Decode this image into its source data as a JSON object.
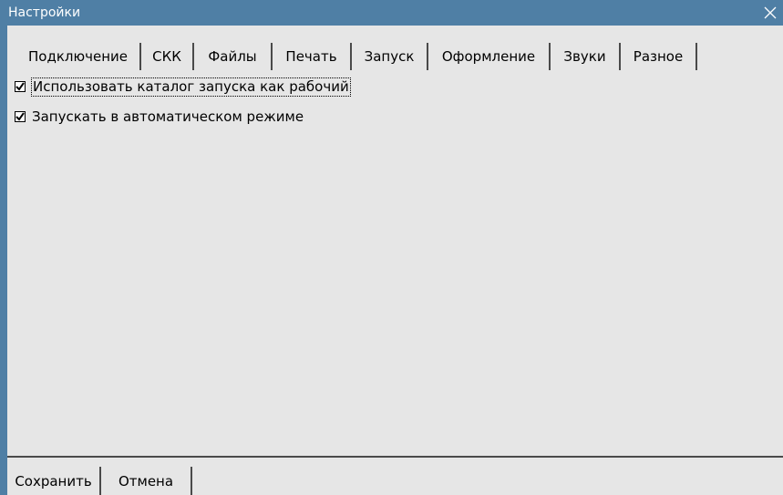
{
  "window": {
    "title": "Настройки",
    "close_icon": "close-icon"
  },
  "tabs": [
    {
      "label": "Подключение",
      "active": false
    },
    {
      "label": "СКК",
      "active": false
    },
    {
      "label": "Файлы",
      "active": false
    },
    {
      "label": "Печать",
      "active": false
    },
    {
      "label": "Запуск",
      "active": true
    },
    {
      "label": "Оформление",
      "active": false
    },
    {
      "label": "Звуки",
      "active": false
    },
    {
      "label": "Разное",
      "active": false
    }
  ],
  "options": [
    {
      "label": "Использовать каталог запуска как рабочий",
      "checked": true
    },
    {
      "label": "Запускать в автоматическом режиме",
      "checked": true
    }
  ],
  "buttons": {
    "save": "Сохранить",
    "cancel": "Отмена"
  },
  "colors": {
    "titlebar": "#4f7fa5",
    "background": "#e6e6e6"
  }
}
